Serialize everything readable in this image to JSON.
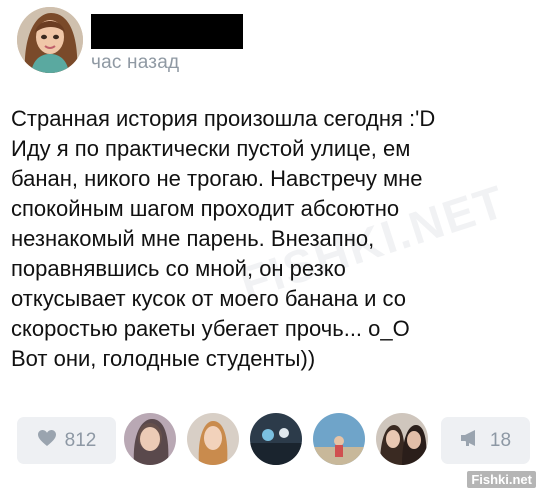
{
  "post": {
    "timestamp": "час назад",
    "text_lines": [
      "Странная история произошла сегодня :'D",
      "Иду я по практически пустой улице, ем",
      "банан, никого не трогаю. Навстречу мне",
      "спокойным шагом проходит абсоютно",
      "незнакомый мне парень. Внезапно,",
      "поравнявшись со мной, он резко",
      "откусывает кусок от моего банана и со",
      "скоростью ракеты убегает прочь... о_О",
      "Вот они, голодные студенты))"
    ]
  },
  "actions": {
    "like_count": "812",
    "like_icon": "heart-icon",
    "share_count": "18",
    "share_icon": "megaphone-icon"
  },
  "colors": {
    "button_bg": "#eef0f3",
    "muted_text": "#8d98a4",
    "timestamp": "#8f99a3"
  },
  "watermark": {
    "corner": "Fishki.net",
    "center": "FISHKI.NET"
  }
}
